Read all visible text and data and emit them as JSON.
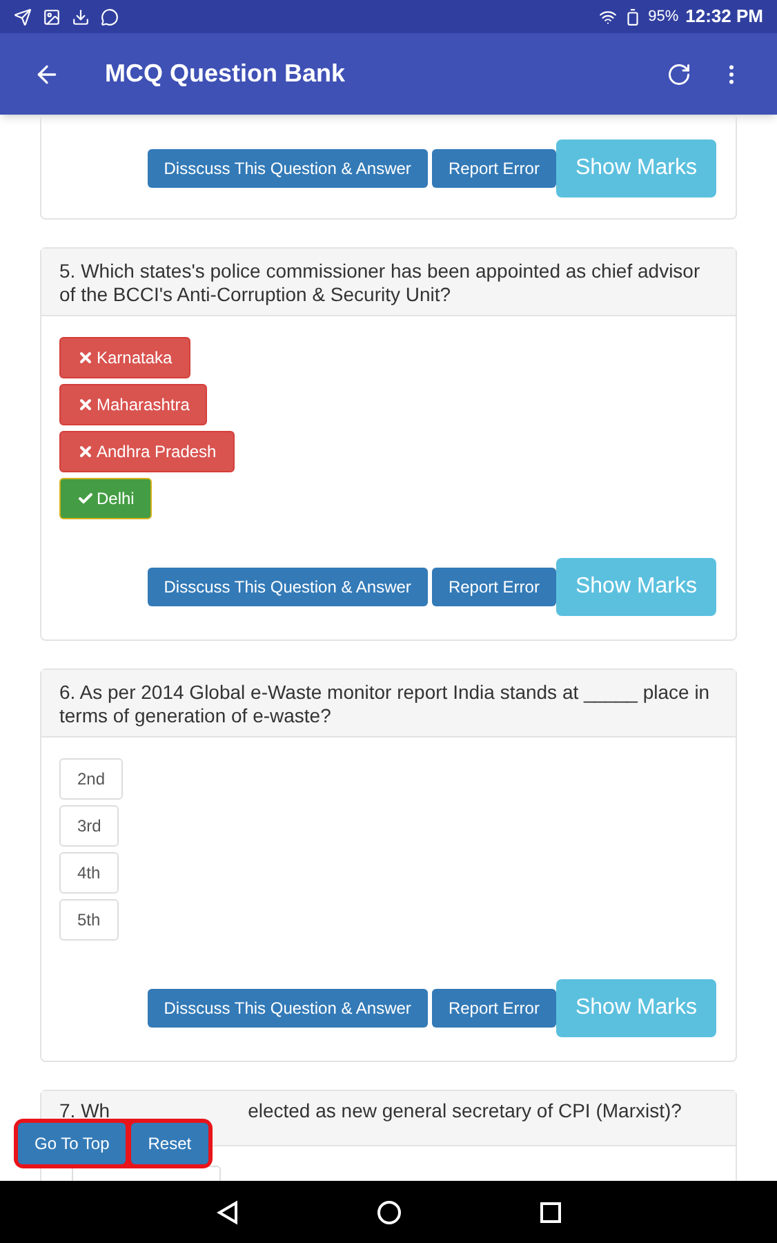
{
  "status_bar": {
    "battery": "95%",
    "time": "12:32 PM"
  },
  "app_bar": {
    "title": "MCQ Question Bank"
  },
  "cards": [
    {
      "kind": "partial_top",
      "actions": [
        {
          "label": "Disscuss This Question & Answer",
          "kind": "discuss"
        },
        {
          "label": "Report Error",
          "kind": "report"
        },
        {
          "label": "Show Marks",
          "kind": "marks"
        }
      ]
    },
    {
      "kind": "full",
      "question": "5. Which states's police commissioner has been appointed as chief advisor of the BCCI's Anti-Corruption & Security Unit?",
      "options": [
        {
          "label": "Karnataka",
          "kind": "wrong"
        },
        {
          "label": "Maharashtra",
          "kind": "wrong"
        },
        {
          "label": "Andhra Pradesh",
          "kind": "wrong"
        },
        {
          "label": "Delhi",
          "kind": "correct"
        }
      ],
      "actions": [
        {
          "label": "Disscuss This Question & Answer",
          "kind": "discuss"
        },
        {
          "label": "Report Error",
          "kind": "report"
        },
        {
          "label": "Show Marks",
          "kind": "marks"
        }
      ]
    },
    {
      "kind": "full",
      "question": "6. As per 2014 Global e-Waste monitor report India stands at _____ place in terms of generation of e-waste?",
      "options": [
        {
          "label": "2nd",
          "kind": "unanswered"
        },
        {
          "label": "3rd",
          "kind": "unanswered"
        },
        {
          "label": "4th",
          "kind": "unanswered"
        },
        {
          "label": "5th",
          "kind": "unanswered"
        }
      ],
      "actions": [
        {
          "label": "Disscuss This Question & Answer",
          "kind": "discuss"
        },
        {
          "label": "Report Error",
          "kind": "report"
        },
        {
          "label": "Show Marks",
          "kind": "marks"
        }
      ]
    },
    {
      "kind": "partial_bottom",
      "question_start": "7. Wh",
      "question_end": "elected as new general secretary of CPI (Marxist)?"
    }
  ],
  "floating_buttons": [
    {
      "label": "Go To Top"
    },
    {
      "label": "Reset"
    }
  ]
}
